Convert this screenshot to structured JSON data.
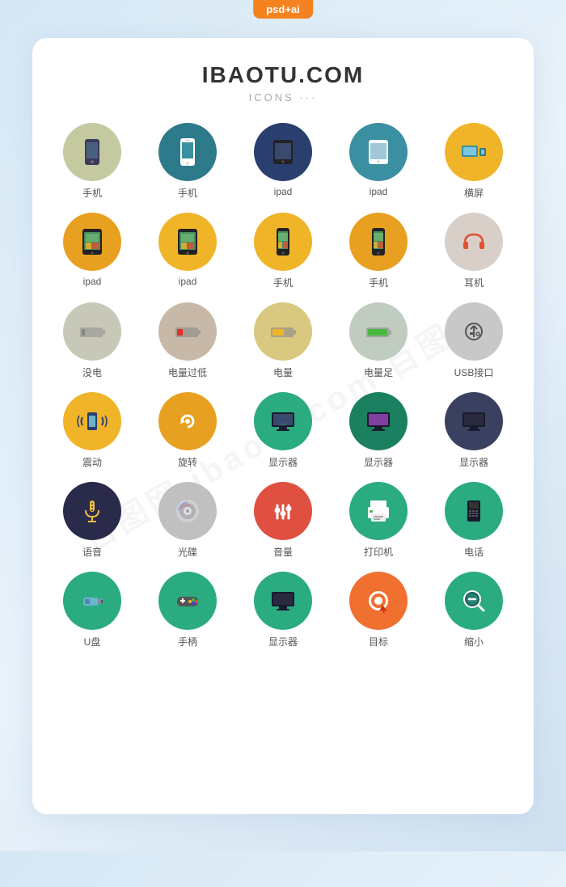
{
  "badge": "psd+ai",
  "title": "IBAOTU.COM",
  "subtitle": "ICONS ···",
  "icons": [
    {
      "label": "手机",
      "bg": "olive",
      "type": "phone-dark"
    },
    {
      "label": "手机",
      "bg": "teal",
      "type": "phone-white"
    },
    {
      "label": "ipad",
      "bg": "navy",
      "type": "ipad-dark"
    },
    {
      "label": "ipad",
      "bg": "lteal",
      "type": "ipad-light"
    },
    {
      "label": "横屏",
      "bg": "yellow",
      "type": "landscape"
    },
    {
      "label": "ipad",
      "bg": "gold",
      "type": "ipad-yellow"
    },
    {
      "label": "ipad",
      "bg": "gold2",
      "type": "ipad-yellow2"
    },
    {
      "label": "手机",
      "bg": "gold3",
      "type": "phone-yellow"
    },
    {
      "label": "手机",
      "bg": "gold4",
      "type": "phone-yellow2"
    },
    {
      "label": "耳机",
      "bg": "lgray",
      "type": "headphone"
    },
    {
      "label": "没电",
      "bg": "lgray2",
      "type": "battery-empty"
    },
    {
      "label": "电量过低",
      "bg": "lgray3",
      "type": "battery-low"
    },
    {
      "label": "电量",
      "bg": "lgray4",
      "type": "battery-mid"
    },
    {
      "label": "电量足",
      "bg": "lgray5",
      "type": "battery-full"
    },
    {
      "label": "USB接口",
      "bg": "lgray6",
      "type": "usb"
    },
    {
      "label": "震动",
      "bg": "yellow2",
      "type": "vibrate"
    },
    {
      "label": "旋转",
      "bg": "yellow3",
      "type": "rotate"
    },
    {
      "label": "显示器",
      "bg": "green",
      "type": "monitor1"
    },
    {
      "label": "显示器",
      "bg": "green2",
      "type": "monitor2"
    },
    {
      "label": "显示器",
      "bg": "dark",
      "type": "monitor3"
    },
    {
      "label": "语音",
      "bg": "dark2",
      "type": "mic"
    },
    {
      "label": "光碟",
      "bg": "gray2",
      "type": "disc"
    },
    {
      "label": "音量",
      "bg": "red",
      "type": "volume"
    },
    {
      "label": "打印机",
      "bg": "green3",
      "type": "printer"
    },
    {
      "label": "电话",
      "bg": "green4",
      "type": "phone2"
    },
    {
      "label": "U盘",
      "bg": "teal2",
      "type": "usb-drive"
    },
    {
      "label": "手柄",
      "bg": "green5",
      "type": "gamepad"
    },
    {
      "label": "显示器",
      "bg": "green6",
      "type": "monitor4"
    },
    {
      "label": "目标",
      "bg": "orange",
      "type": "target"
    },
    {
      "label": "缩小",
      "bg": "teal3",
      "type": "zoom-out"
    }
  ]
}
